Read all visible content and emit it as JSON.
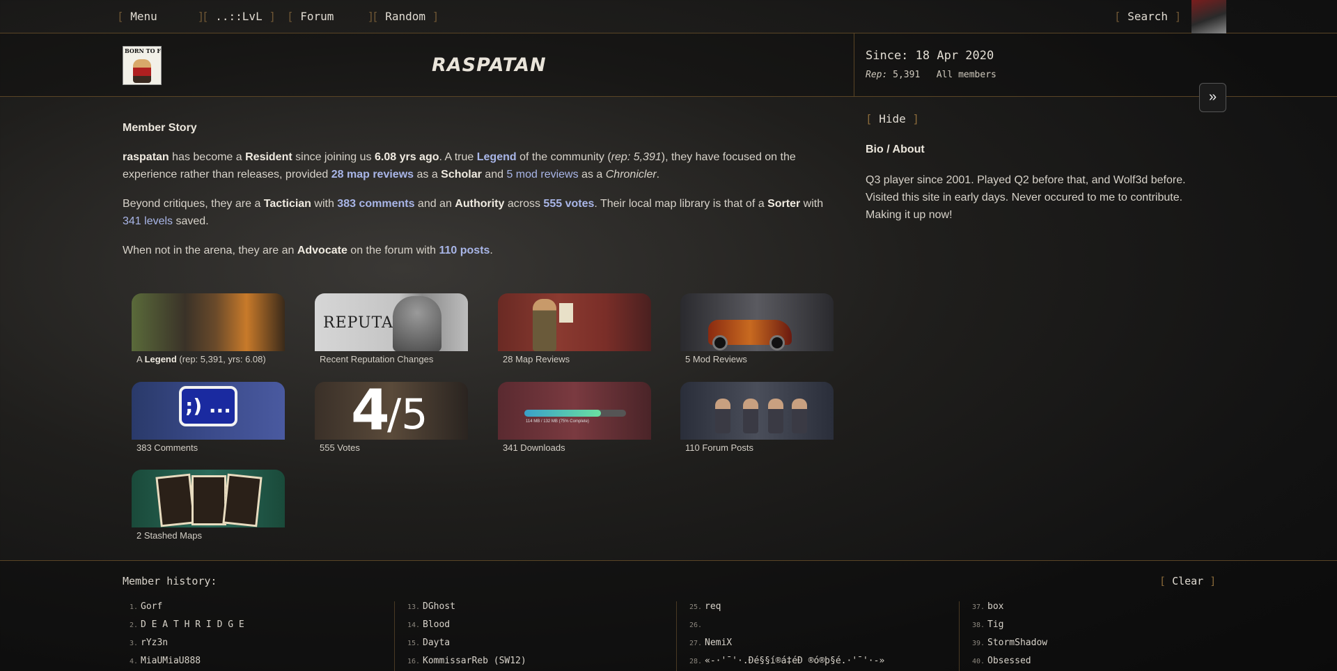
{
  "nav": {
    "menu": "Menu",
    "lvl": "..::LvL",
    "forum": "Forum",
    "random": "Random",
    "search": "Search"
  },
  "profile": {
    "logo_text": "BORN TO FRAG",
    "username": "RASPATAN",
    "since": "Since: 18 Apr 2020",
    "rep_label": "Rep:",
    "rep_value": "5,391",
    "all_members": "All members",
    "expand_icon": "»"
  },
  "story": {
    "title": "Member Story",
    "p1": {
      "name": "raspatan",
      "t1": " has become a ",
      "rank": "Resident",
      "t2": " since joining us ",
      "years": "6.08 yrs ago",
      "t3": ". A true ",
      "legend": "Legend",
      "t4": " of the community (",
      "rep": "rep: 5,391",
      "t5": "), they have focused on the experience rather than releases, provided ",
      "map_reviews": "28 map reviews",
      "t6": " as a ",
      "scholar": "Scholar",
      "t7": " and ",
      "mod_reviews": "5 mod reviews",
      "t8": " as a ",
      "chronicler": "Chronicler",
      "t9": "."
    },
    "p2": {
      "t1": "Beyond critiques, they are a ",
      "tactician": "Tactician",
      "t2": " with ",
      "comments": "383 comments",
      "t3": " and an ",
      "authority": "Authority",
      "t4": " across ",
      "votes": "555 votes",
      "t5": ". Their local map library is that of a ",
      "sorter": "Sorter",
      "t6": " with ",
      "levels": "341 levels",
      "t7": " saved."
    },
    "p3": {
      "t1": "When not in the arena, they are an ",
      "advocate": "Advocate",
      "t2": " on the forum with ",
      "posts": "110 posts",
      "t3": "."
    }
  },
  "cards": {
    "c1": {
      "pre": "A ",
      "bold": "Legend",
      "post": " (rep: 5,391, yrs: 6.08)"
    },
    "c2": {
      "label": "Recent Reputation Changes",
      "img_text": "REPUTATION"
    },
    "c3": {
      "label": "28 Map Reviews"
    },
    "c4": {
      "label": "5 Mod Reviews"
    },
    "c5": {
      "label": "383 Comments",
      "img_text": ";) ..."
    },
    "c6": {
      "label": "555 Votes",
      "img_big": "4",
      "img_small": "/5"
    },
    "c7": {
      "label": "341 Downloads",
      "img_text": "114 MB / 132 MB (75% Complete)",
      "progress": 0.75
    },
    "c8": {
      "label": "110 Forum Posts"
    },
    "c9": {
      "label": "2 Stashed Maps"
    }
  },
  "bio": {
    "hide": "Hide",
    "title": "Bio / About",
    "text": "Q3 player since 2001. Played Q2 before that, and Wolf3d before. Visited this site in early days. Never occured to me to contribute. Making it up now!"
  },
  "history": {
    "title": "Member history:",
    "clear": "Clear",
    "columns": [
      [
        {
          "n": "1.",
          "name": "Gorf"
        },
        {
          "n": "2.",
          "name": "D E A T H R I D G E"
        },
        {
          "n": "3.",
          "name": "rYz3n"
        },
        {
          "n": "4.",
          "name": "MiaUMiaU888"
        }
      ],
      [
        {
          "n": "13.",
          "name": "DGhost"
        },
        {
          "n": "14.",
          "name": "Blood"
        },
        {
          "n": "15.",
          "name": "Dayta"
        },
        {
          "n": "16.",
          "name": "KommissarReb (SW12)"
        }
      ],
      [
        {
          "n": "25.",
          "name": "req"
        },
        {
          "n": "26.",
          "name": ""
        },
        {
          "n": "27.",
          "name": "NemiX"
        },
        {
          "n": "28.",
          "name": "«-·'¯'·.Ðé§§í®á‡éÐ ®ó®þ§é.·'¯'·-»"
        }
      ],
      [
        {
          "n": "37.",
          "name": "box"
        },
        {
          "n": "38.",
          "name": "Tig"
        },
        {
          "n": "39.",
          "name": "StormShadow"
        },
        {
          "n": "40.",
          "name": "Obsessed"
        }
      ]
    ]
  },
  "colors": {
    "accent_link": "#a9b6e8",
    "bracket": "#8a6a3a",
    "divider": "#5a4526"
  }
}
